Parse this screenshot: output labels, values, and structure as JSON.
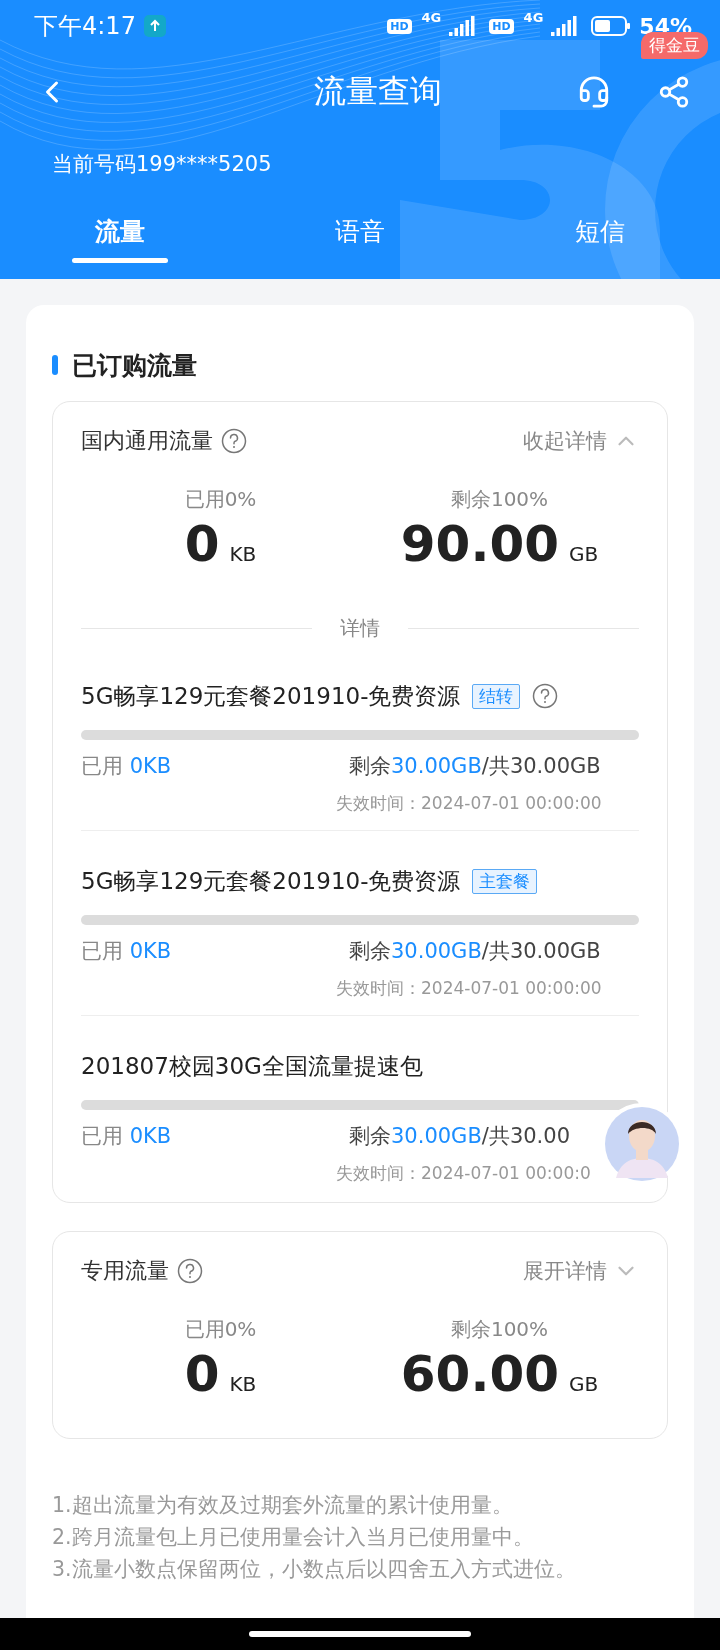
{
  "status_bar": {
    "time": "下午4:17",
    "networks": [
      {
        "hd": "HD",
        "type": "4G"
      },
      {
        "hd": "HD",
        "type": "4G"
      }
    ],
    "battery": "54%"
  },
  "header": {
    "title": "流量查询",
    "badge": "得金豆",
    "phone": "当前号码199****5205"
  },
  "tabs": [
    {
      "label": "流量",
      "selected": true
    },
    {
      "label": "语音",
      "selected": false
    },
    {
      "label": "短信",
      "selected": false
    }
  ],
  "section": {
    "title": "已订购流量",
    "cards": [
      {
        "title": "国内通用流量",
        "toggle": "收起详情",
        "expanded": true,
        "used_label": "已用0%",
        "used_value": "0",
        "used_unit": "KB",
        "remaining_label": "剩余100%",
        "remaining_value": "90.00",
        "remaining_unit": "GB",
        "details_label": "详情",
        "packages": [
          {
            "name": "5G畅享129元套餐201910-免费资源",
            "tag": "结转",
            "help": true,
            "used_label": "已用",
            "used_value": "0KB",
            "remaining_label": "剩余",
            "remaining_value": "30.00GB",
            "total": "/共30.00GB",
            "expiry": "失效时间：2024-07-01 00:00:00"
          },
          {
            "name": "5G畅享129元套餐201910-免费资源",
            "tag": "主套餐",
            "help": false,
            "used_label": "已用",
            "used_value": "0KB",
            "remaining_label": "剩余",
            "remaining_value": "30.00GB",
            "total": "/共30.00GB",
            "expiry": "失效时间：2024-07-01 00:00:00"
          },
          {
            "name": "201807校园30G全国流量提速包",
            "help": false,
            "used_label": "已用",
            "used_value": "0KB",
            "remaining_label": "剩余",
            "remaining_value": "30.00GB",
            "total": "/共30.00",
            "expiry": "失效时间：2024-07-01 00:00:0"
          }
        ]
      },
      {
        "title": "专用流量",
        "toggle": "展开详情",
        "expanded": false,
        "used_label": "已用0%",
        "used_value": "0",
        "used_unit": "KB",
        "remaining_label": "剩余100%",
        "remaining_value": "60.00",
        "remaining_unit": "GB"
      }
    ]
  },
  "notes": [
    "1.超出流量为有效及过期套外流量的累计使用量。",
    "2.跨月流量包上月已使用量会计入当月已使用量中。",
    "3.流量小数点保留两位，小数点后以四舍五入方式进位。"
  ]
}
